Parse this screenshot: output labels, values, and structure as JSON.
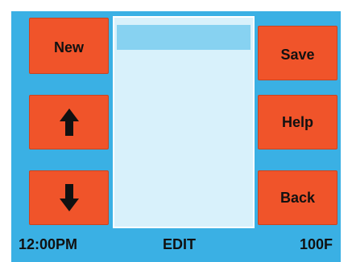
{
  "buttons": {
    "new_label": "New",
    "save_label": "Save",
    "help_label": "Help",
    "back_label": "Back",
    "up_icon": "arrow-up-icon",
    "down_icon": "arrow-down-icon"
  },
  "status_bar": {
    "time": "12:00PM",
    "mode": "EDIT",
    "temperature": "100F"
  },
  "colors": {
    "background": "#3ab0e4",
    "button": "#f0542a",
    "list_panel": "#d8f1fb",
    "list_selection": "#87d2f1"
  }
}
